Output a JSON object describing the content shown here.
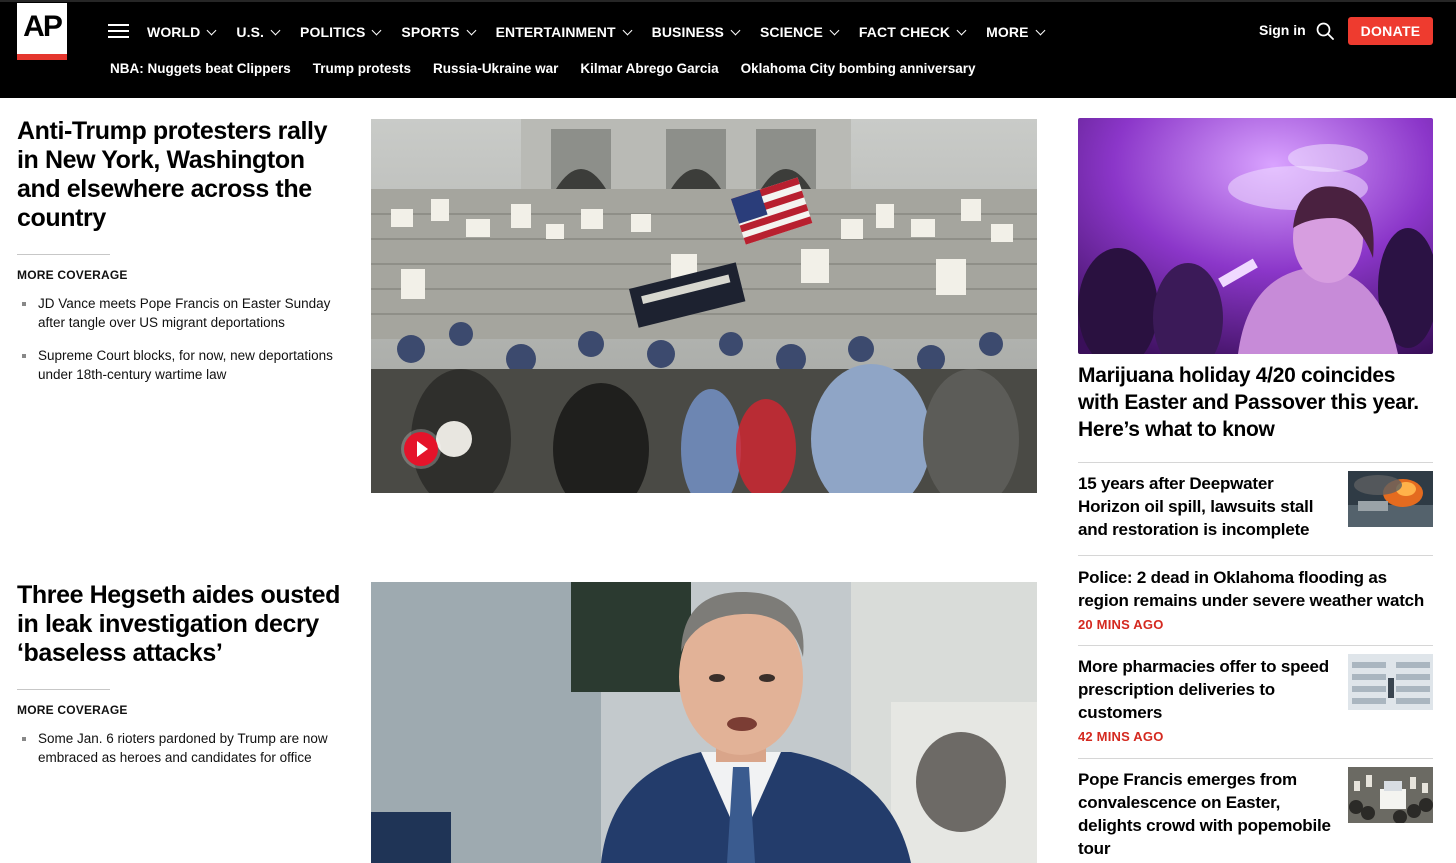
{
  "header": {
    "logo_text": "AP",
    "nav": [
      {
        "label": "WORLD"
      },
      {
        "label": "U.S."
      },
      {
        "label": "POLITICS"
      },
      {
        "label": "SPORTS"
      },
      {
        "label": "ENTERTAINMENT"
      },
      {
        "label": "BUSINESS"
      },
      {
        "label": "SCIENCE"
      },
      {
        "label": "FACT CHECK"
      },
      {
        "label": "MORE"
      }
    ],
    "sign_in": "Sign in",
    "donate": "DONATE",
    "trending": [
      "NBA: Nuggets beat Clippers",
      "Trump protests",
      "Russia-Ukraine war",
      "Kilmar Abrego Garcia",
      "Oklahoma City bombing anniversary"
    ],
    "colors": {
      "background": "#000000",
      "donate": "#ee3b2f",
      "logo_bar": "#e5362e"
    }
  },
  "lead_stories": [
    {
      "headline": "Anti-Trump protesters rally in New York, Washington and elsewhere across the country",
      "more_coverage_label": "MORE COVERAGE",
      "related": [
        "JD Vance meets Pope Francis on Easter Sunday after tangle over US migrant deportations",
        "Supreme Court blocks, for now, new deportations under 18th-century wartime law"
      ],
      "has_video": true
    },
    {
      "headline": "Three Hegseth aides ousted in leak investigation decry ‘baseless attacks’",
      "more_coverage_label": "MORE COVERAGE",
      "related": [
        "Some Jan. 6 rioters pardoned by Trump are now embraced as heroes and candidates for office"
      ]
    }
  ],
  "rail": {
    "hero_title": "Marijuana holiday 4/20 coincides with Easter and Passover this year. Here’s what to know",
    "stories": [
      {
        "title": "15 years after Deepwater Horizon oil spill, lawsuits stall and restoration is incomplete",
        "time": "",
        "thumb": "oil-spill-fire"
      },
      {
        "title": "Police: 2 dead in Oklahoma flooding as region remains under severe weather watch",
        "time": "20 MINS AGO",
        "thumb": ""
      },
      {
        "title": "More pharmacies offer to speed prescription deliveries to customers",
        "time": "42 MINS AGO",
        "thumb": "pharmacy-warehouse"
      },
      {
        "title": "Pope Francis emerges from convalescence on Easter, delights crowd with popemobile tour",
        "time": "",
        "thumb": "popemobile-crowd"
      }
    ],
    "accent_time_color": "#d4291f"
  }
}
